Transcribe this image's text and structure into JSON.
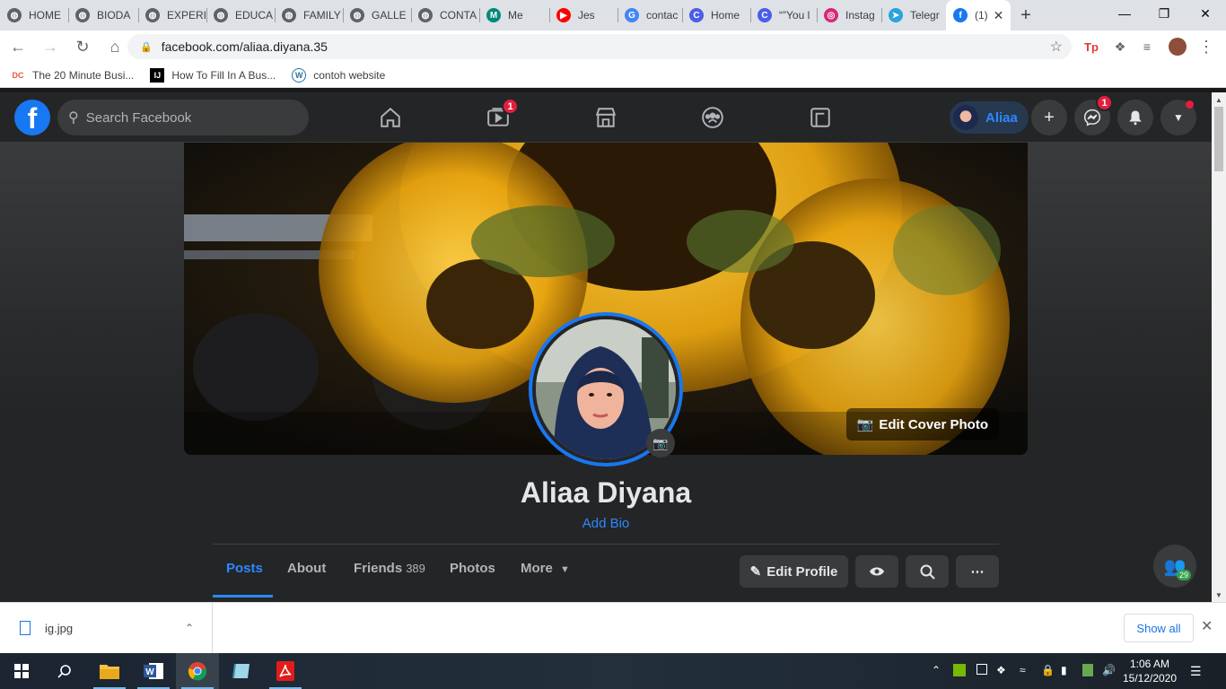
{
  "browser": {
    "tabs": [
      {
        "label": "HOME",
        "icon": "globe-icon",
        "color": "#5f6368"
      },
      {
        "label": "BIODA",
        "icon": "globe-icon",
        "color": "#5f6368"
      },
      {
        "label": "EXPERI",
        "icon": "globe-icon",
        "color": "#5f6368"
      },
      {
        "label": "EDUCA",
        "icon": "globe-icon",
        "color": "#5f6368"
      },
      {
        "label": "FAMILY",
        "icon": "globe-icon",
        "color": "#5f6368"
      },
      {
        "label": "GALLE",
        "icon": "globe-icon",
        "color": "#5f6368"
      },
      {
        "label": "CONTA",
        "icon": "globe-icon",
        "color": "#5f6368"
      },
      {
        "label": "Me",
        "icon": "meet-icon",
        "color": "#00897b"
      },
      {
        "label": "Jes",
        "icon": "youtube-icon",
        "color": "#ff0000"
      },
      {
        "label": "contac",
        "icon": "google-icon",
        "color": "#4285f4"
      },
      {
        "label": "Home",
        "icon": "canva-icon",
        "color": "#4a5ee8"
      },
      {
        "label": "“”You l",
        "icon": "canva-icon",
        "color": "#4a5ee8"
      },
      {
        "label": "Instag",
        "icon": "instagram-icon",
        "color": "#d62976"
      },
      {
        "label": "Telegr",
        "icon": "telegram-icon",
        "color": "#2aa3df"
      },
      {
        "label": "(1)",
        "icon": "facebook-icon",
        "color": "#1877f2"
      }
    ],
    "url": "facebook.com/aliaa.diyana.35",
    "bookmarks": [
      {
        "label": "The 20 Minute Busi...",
        "icon": "dc-icon"
      },
      {
        "label": "How To Fill In A Bus...",
        "icon": "ij-icon"
      },
      {
        "label": "contoh website",
        "icon": "wordpress-icon"
      }
    ]
  },
  "facebook": {
    "search_placeholder": "Search Facebook",
    "watch_badge": "1",
    "messenger_badge": "1",
    "profile_chip_name": "Aliaa",
    "accent": "#2d88ff",
    "profile": {
      "name": "Aliaa Diyana",
      "add_bio": "Add Bio",
      "edit_cover": "Edit Cover Photo",
      "tabs": {
        "posts": "Posts",
        "about": "About",
        "friends": "Friends",
        "friends_count": "389",
        "photos": "Photos",
        "more": "More"
      },
      "edit_profile": "Edit Profile"
    },
    "contacts_count": "29"
  },
  "downloads": {
    "file": "ig.jpg",
    "show_all": "Show all"
  },
  "taskbar": {
    "time": "1:06 AM",
    "date": "15/12/2020"
  }
}
